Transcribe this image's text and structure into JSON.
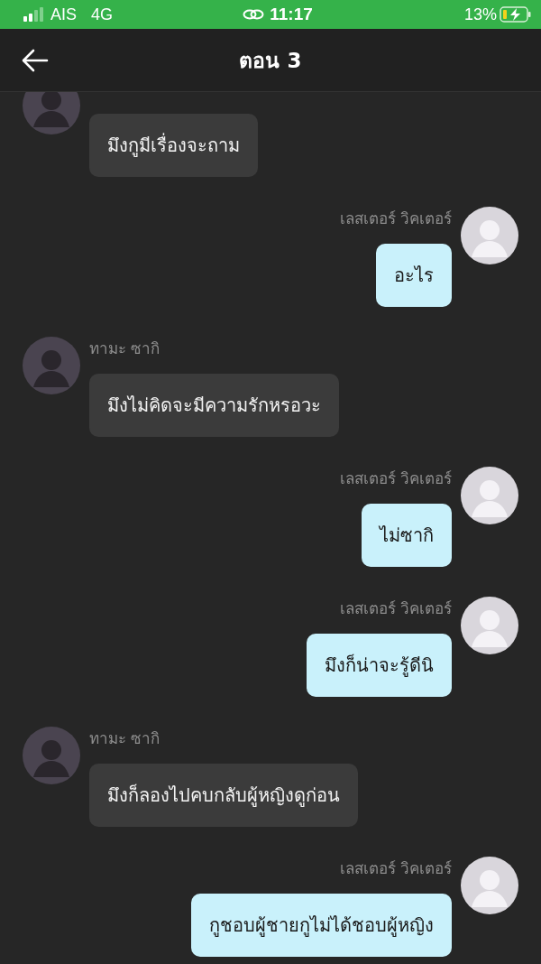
{
  "status_bar": {
    "carrier": "AIS",
    "network": "4G",
    "time": "11:17",
    "battery": "13%"
  },
  "header": {
    "title": "ตอน 3"
  },
  "messages": [
    {
      "kind": "left",
      "text": "มึงกูมีเรื่องจะถาม"
    },
    {
      "kind": "right",
      "name": "เลสเตอร์ วิคเตอร์",
      "text": "อะไร"
    },
    {
      "kind": "left",
      "name": "ทามะ ซากิ",
      "text": "มึงไม่คิดจะมีความรักหรอวะ"
    },
    {
      "kind": "right",
      "name": "เลสเตอร์ วิคเตอร์",
      "text": "ไม่ซากิ"
    },
    {
      "kind": "right",
      "name": "เลสเตอร์ วิคเตอร์",
      "text": "มึงก็น่าจะรู้ดีนิ"
    },
    {
      "kind": "left",
      "name": "ทามะ ซากิ",
      "text": "มึงก็ลองไปคบกลับผู้หญิงดูก่อน"
    },
    {
      "kind": "right",
      "name": "เลสเตอร์ วิคเตอร์",
      "text": "กูชอบผู้ชายกูไม่ได้ชอบผู้หญิง"
    }
  ]
}
